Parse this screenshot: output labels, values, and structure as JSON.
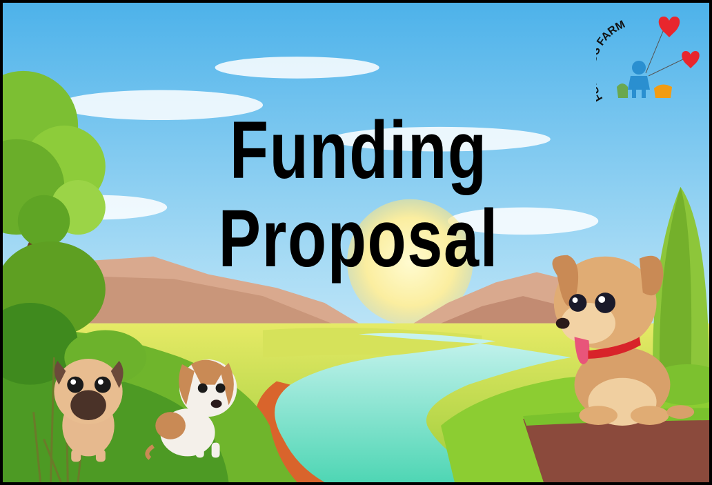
{
  "title": {
    "line1": "Funding",
    "line2": "Proposal"
  },
  "logo": {
    "text": "FUR KIDS FARM",
    "icon": "girl-with-pets-heart-balloons-icon"
  },
  "illustration": {
    "scene": "river-valley-landscape",
    "characters": [
      "pug-dog-icon",
      "beagle-puppy-icon",
      "tan-puppy-red-collar-icon"
    ]
  },
  "colors": {
    "sky": "#7ec8ef",
    "grass": "#8cc63f",
    "river": "#6fe0c8",
    "title": "#000000",
    "heart": "#e8262d",
    "logo_blue": "#2a8fd0",
    "logo_green": "#6aa84f",
    "logo_orange": "#f39c12"
  }
}
